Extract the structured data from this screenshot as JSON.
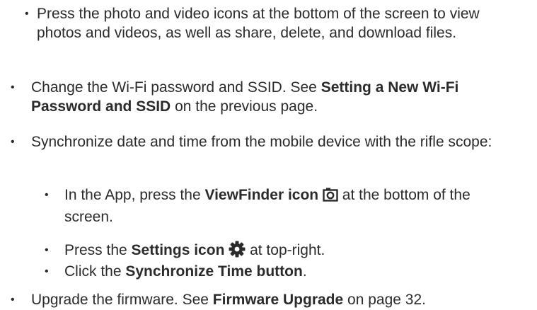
{
  "bullet_char": "•",
  "items": [
    {
      "level": 2,
      "parts": [
        {
          "text": "Press the photo and video icons at the bottom of the screen to view photos and videos, as well as share, delete, and download files.",
          "bold": false
        }
      ]
    },
    {
      "level": 1,
      "parts": [
        {
          "text": "Change the Wi-Fi password and SSID. See ",
          "bold": false
        },
        {
          "text": "Setting a New Wi-Fi Password and SSID",
          "bold": true
        },
        {
          "text": " on the previous page.",
          "bold": false
        }
      ]
    },
    {
      "level": 1,
      "parts": [
        {
          "text": "Synchronize date and time from the mobile device with the rifle scope:",
          "bold": false
        }
      ]
    },
    {
      "level": 2,
      "parts": [
        {
          "text": "In the App, press the ",
          "bold": false
        },
        {
          "text": "ViewFinder icon",
          "bold": true
        },
        {
          "text": " ",
          "bold": false
        },
        {
          "icon": "camera-icon"
        },
        {
          "text": " at the bottom of the screen.",
          "bold": false
        }
      ]
    },
    {
      "level": 2,
      "parts": [
        {
          "text": "Press the ",
          "bold": false
        },
        {
          "text": "Settings icon",
          "bold": true
        },
        {
          "text": " ",
          "bold": false
        },
        {
          "icon": "gear-icon"
        },
        {
          "text": " at top-right.",
          "bold": false
        }
      ]
    },
    {
      "level": 2,
      "parts": [
        {
          "text": "Click the ",
          "bold": false
        },
        {
          "text": "Synchronize Time button",
          "bold": true
        },
        {
          "text": ".",
          "bold": false
        }
      ]
    },
    {
      "level": 1,
      "parts": [
        {
          "text": "Upgrade the firmware. See ",
          "bold": false
        },
        {
          "text": "Firmware Upgrade",
          "bold": true
        },
        {
          "text": " on page 32.",
          "bold": false
        }
      ]
    }
  ]
}
